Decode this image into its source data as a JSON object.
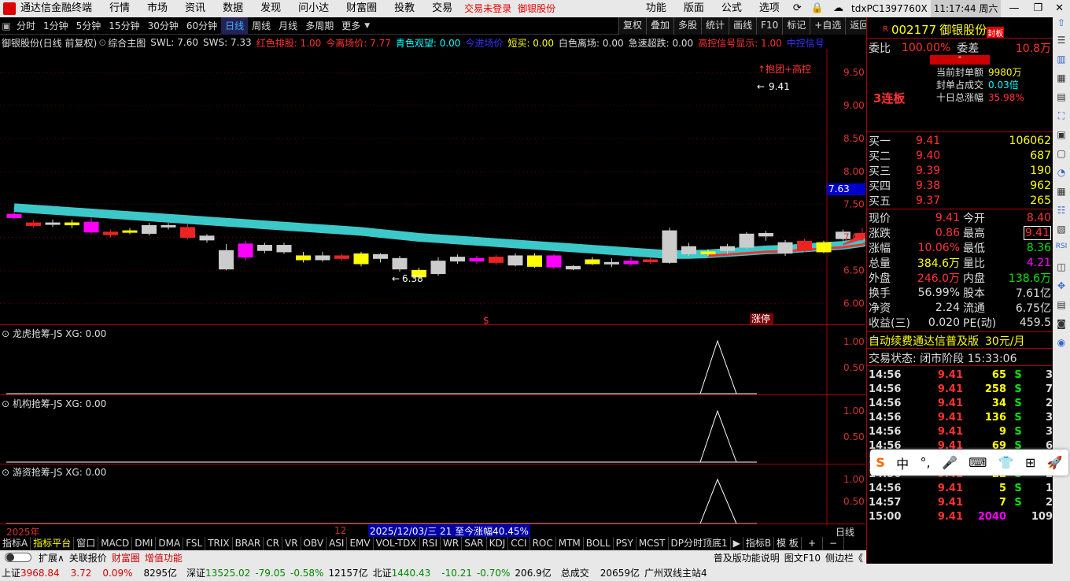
{
  "menubar": {
    "app_title": "通达信金融终端",
    "items": [
      "行情",
      "市场",
      "资讯",
      "数据",
      "发现",
      "问小达",
      "财富圈",
      "投教",
      "交易"
    ],
    "login": "交易未登录",
    "stock": "御银股份",
    "right_items": [
      "功能",
      "版面",
      "公式",
      "选项"
    ],
    "machine": "tdxPC1397760X",
    "clock": "11:17:44 周六"
  },
  "periodbar": {
    "items": [
      "分时",
      "1分钟",
      "5分钟",
      "15分钟",
      "30分钟",
      "60分钟",
      "日线",
      "周线",
      "月线",
      "多周期",
      "更多"
    ],
    "active": "日线",
    "right": [
      "复权",
      "叠加",
      "多股",
      "统计",
      "画线",
      "F10",
      "标记",
      "+自选",
      "返回"
    ]
  },
  "chart": {
    "header": {
      "name": "御银股份(日线 前复权)",
      "formula": "综合主图",
      "swl": "SWL: 7.60",
      "sws": "SWS: 7.33",
      "red_rank": "红色排股: 1.00",
      "today_exit": "今离场价: 7.77",
      "cyan_watch": "青色观望: 0.00",
      "today_entry": "今进场价",
      "short_buy": "短买: 0.00",
      "white_exit": "白色离场: 0.00",
      "drop": "急速超跌: 0.00",
      "high_signal": "高控信号显示: 1.00",
      "mid_signal": "中控信号"
    },
    "y_ticks": [
      "9.50",
      "9.00",
      "8.50",
      "8.00",
      "7.50",
      "7.00",
      "6.50",
      "6.00"
    ],
    "price_tag": "7.63",
    "annotations": {
      "top": "↑抱团+高控",
      "high": "9.41",
      "low": "6.38",
      "zhangting": "涨停"
    },
    "time_bar": {
      "year": "2025年",
      "month": "12",
      "info": "2025/12/03/三 21 至今涨幅40.45%",
      "period": "日线"
    }
  },
  "subcharts": [
    {
      "title": "龙虎抢筹-JS XG: 0.00",
      "ticks": [
        "1.00",
        "0.50"
      ]
    },
    {
      "title": "机构抢筹-JS XG: 0.00",
      "ticks": [
        "1.00",
        "0.50"
      ]
    },
    {
      "title": "游资抢筹-JS XG: 0.00",
      "ticks": [
        "1.00",
        "0.50"
      ]
    }
  ],
  "chart_data": {
    "type": "candlestick",
    "ylim": [
      5.8,
      9.8
    ],
    "candles": [
      [
        7.35,
        7.3,
        7.38,
        7.28
      ],
      [
        7.22,
        7.18,
        7.26,
        7.15
      ],
      [
        7.22,
        7.2,
        7.27,
        7.16
      ],
      [
        7.19,
        7.22,
        7.27,
        7.14
      ],
      [
        7.23,
        7.08,
        7.3,
        7.06
      ],
      [
        7.08,
        7.04,
        7.12,
        7.0
      ],
      [
        7.08,
        7.1,
        7.14,
        7.05
      ],
      [
        7.06,
        7.18,
        7.22,
        7.03
      ],
      [
        7.16,
        7.18,
        7.22,
        7.12
      ],
      [
        7.15,
        7.0,
        7.2,
        6.97
      ],
      [
        7.02,
        6.96,
        7.05,
        6.92
      ],
      [
        6.8,
        6.52,
        6.9,
        6.5
      ],
      [
        6.9,
        6.7,
        6.95,
        6.65
      ],
      [
        6.8,
        6.88,
        6.92,
        6.76
      ],
      [
        6.88,
        6.78,
        6.92,
        6.75
      ],
      [
        6.66,
        6.72,
        6.78,
        6.62
      ],
      [
        6.66,
        6.72,
        6.78,
        6.63
      ],
      [
        6.72,
        6.68,
        6.75,
        6.65
      ],
      [
        6.6,
        6.75,
        6.78,
        6.56
      ],
      [
        6.68,
        6.74,
        6.76,
        6.62
      ],
      [
        6.52,
        6.68,
        6.72,
        6.48
      ],
      [
        6.4,
        6.5,
        6.54,
        6.38
      ],
      [
        6.45,
        6.64,
        6.7,
        6.42
      ],
      [
        6.64,
        6.7,
        6.74,
        6.6
      ],
      [
        6.68,
        6.64,
        6.72,
        6.6
      ],
      [
        6.7,
        6.62,
        6.74,
        6.58
      ],
      [
        6.72,
        6.58,
        6.76,
        6.56
      ],
      [
        6.56,
        6.72,
        6.76,
        6.54
      ],
      [
        6.72,
        6.55,
        6.75,
        6.52
      ],
      [
        6.52,
        6.56,
        6.58,
        6.5
      ],
      [
        6.6,
        6.66,
        6.7,
        6.58
      ],
      [
        6.62,
        6.6,
        6.68,
        6.55
      ],
      [
        6.64,
        6.6,
        6.7,
        6.57
      ],
      [
        6.66,
        6.63,
        6.7,
        6.6
      ],
      [
        6.62,
        7.1,
        7.15,
        6.6
      ],
      [
        6.86,
        6.75,
        6.92,
        6.72
      ],
      [
        6.75,
        6.78,
        6.82,
        6.72
      ],
      [
        6.8,
        6.86,
        6.9,
        6.75
      ],
      [
        6.85,
        7.05,
        7.08,
        6.82
      ],
      [
        7.06,
        7.02,
        7.1,
        6.95
      ],
      [
        6.76,
        6.92,
        6.96,
        6.72
      ],
      [
        6.94,
        6.8,
        6.98,
        6.78
      ],
      [
        6.78,
        6.92,
        6.95,
        6.76
      ],
      [
        6.98,
        7.08,
        7.12,
        6.95
      ],
      [
        7.0,
        7.06,
        7.14,
        6.96
      ],
      [
        7.0,
        7.76,
        7.8,
        6.98
      ],
      [
        8.58,
        8.58,
        8.6,
        8.15
      ],
      [
        8.4,
        9.41,
        9.41,
        8.4
      ]
    ],
    "ma_band": [
      7.45,
      7.43,
      7.41,
      7.39,
      7.37,
      7.35,
      7.33,
      7.31,
      7.29,
      7.27,
      7.25,
      7.23,
      7.21,
      7.19,
      7.17,
      7.15,
      7.13,
      7.11,
      7.09,
      7.06,
      7.03,
      7.0,
      6.98,
      6.96,
      6.94,
      6.92,
      6.9,
      6.88,
      6.86,
      6.84,
      6.82,
      6.8,
      6.78,
      6.76,
      6.74,
      6.74,
      6.75,
      6.77,
      6.79,
      6.81,
      6.82,
      6.84,
      6.86,
      6.88,
      6.92,
      7.05,
      7.3,
      7.55
    ]
  },
  "quote": {
    "code": "002177",
    "name": "御银股份",
    "seal": "封板",
    "weibi_label": "委比",
    "weibi": "100.00%",
    "weicha_label": "委差",
    "weicha": "10.8万",
    "lianban": "3连板",
    "seal_amt_label": "当前封单额",
    "seal_amt": "9980万",
    "seal_ratio_label": "封单占成交",
    "seal_ratio": "0.03倍",
    "ten_day_label": "十日总涨幅",
    "ten_day": "35.98%",
    "bids": [
      {
        "l": "买一",
        "p": "9.41",
        "v": "106062"
      },
      {
        "l": "买二",
        "p": "9.40",
        "v": "687"
      },
      {
        "l": "买三",
        "p": "9.39",
        "v": "190"
      },
      {
        "l": "买四",
        "p": "9.38",
        "v": "962"
      },
      {
        "l": "买五",
        "p": "9.37",
        "v": "265"
      }
    ],
    "stats": [
      [
        "现价",
        "9.41",
        "今开",
        "8.40"
      ],
      [
        "涨跌",
        "0.86",
        "最高",
        "9.41"
      ],
      [
        "涨幅",
        "10.06%",
        "最低",
        "8.36"
      ],
      [
        "总量",
        "384.6万",
        "量比",
        "4.21"
      ],
      [
        "外盘",
        "246.0万",
        "内盘",
        "138.6万"
      ],
      [
        "换手",
        "56.99%",
        "股本",
        "7.61亿"
      ],
      [
        "净资",
        "2.24",
        "流通",
        "6.75亿"
      ],
      [
        "收益(三)",
        "0.020",
        "PE(动)",
        "459.5"
      ]
    ],
    "ad": "自动续费通达信普及版",
    "ad_price": "30元/月",
    "trade_status": "交易状态: 闭市阶段 15:33:06",
    "ticks": [
      [
        "14:56",
        "9.41",
        "65",
        "S",
        "3"
      ],
      [
        "14:56",
        "9.41",
        "258",
        "S",
        "7"
      ],
      [
        "14:56",
        "9.41",
        "34",
        "S",
        "2"
      ],
      [
        "14:56",
        "9.41",
        "136",
        "S",
        "3"
      ],
      [
        "14:56",
        "9.41",
        "9",
        "S",
        "3"
      ],
      [
        "14:56",
        "9.41",
        "69",
        "S",
        "6"
      ],
      [
        "14:56",
        "9.41",
        "37",
        "S",
        "2"
      ],
      [
        "14:56",
        "9.41",
        "22",
        "S",
        "2"
      ],
      [
        "14:56",
        "9.41",
        "5",
        "S",
        "1"
      ],
      [
        "14:57",
        "9.41",
        "7",
        "S",
        "2"
      ],
      [
        "15:00",
        "9.41",
        "2040",
        "",
        "109"
      ]
    ],
    "bottom_tabs": [
      "笔",
      "价",
      "细",
      "势",
      "联",
      "值",
      "主",
      "逆",
      "筹"
    ]
  },
  "ime": {
    "items": [
      "中",
      "°,",
      "🎤",
      "⌨",
      "👕",
      "⊞",
      "🚀"
    ]
  },
  "bottom_tabs": [
    "指标A",
    "指标平台",
    "窗口",
    "MACD",
    "DMI",
    "DMA",
    "FSL",
    "TRIX",
    "BRAR",
    "CR",
    "VR",
    "OBV",
    "ASI",
    "EMV",
    "VOL-TDX",
    "RSI",
    "WR",
    "SAR",
    "KDJ",
    "CCI",
    "ROC",
    "MTM",
    "BOLL",
    "PSY",
    "MCST",
    "DP分时顶底1",
    "指标B",
    "模 板",
    "+",
    "−"
  ],
  "ext": {
    "items": [
      "扩展∧",
      "关联报价",
      "财富圈",
      "增值功能"
    ],
    "right": [
      "普及版功能说明",
      "图文F10",
      "侧边栏《"
    ]
  },
  "status": {
    "sh_label": "上证",
    "sh": "3968.84",
    "sh_chg": "3.72",
    "sh_pct": "0.09%",
    "sh_amt": "8295亿",
    "sz_label": "深证",
    "sz": "13525.02",
    "sz_chg": "-79.05",
    "sz_pct": "-0.58%",
    "sz_amt": "12157亿",
    "bz_label": "北证",
    "bz": "1440.43",
    "bz_chg": "-10.21",
    "bz_pct": "-0.70%",
    "bz_amt": "206.9亿",
    "total_label": "总成交",
    "total": "20659亿",
    "station": "广州双线主站4"
  }
}
